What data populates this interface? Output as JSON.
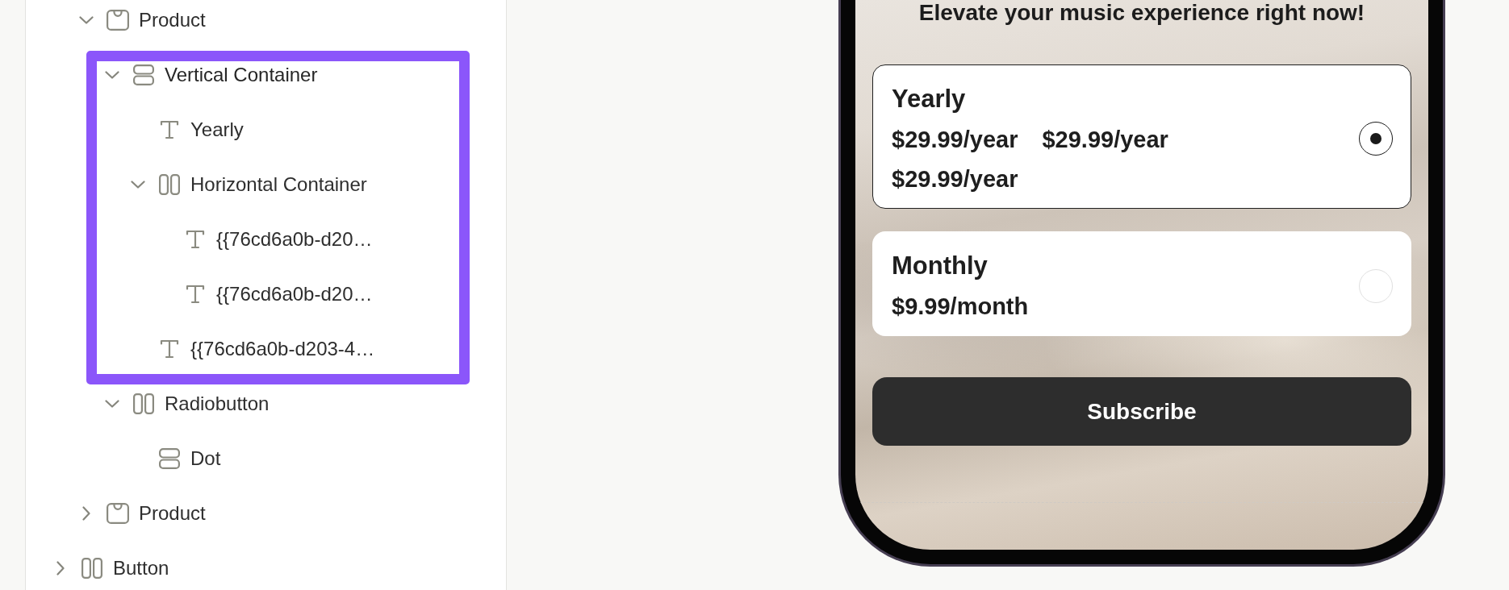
{
  "tree": [
    {
      "children": [
        {
          "label": "Product",
          "kind": "product",
          "expanded": true,
          "selected": false,
          "children": [
            {
              "label": "Vertical Container",
              "kind": "vstack",
              "expanded": true,
              "selected": true,
              "children": [
                {
                  "label": "Yearly",
                  "kind": "text",
                  "selected": false
                },
                {
                  "label": "Horizontal Container",
                  "kind": "hstack",
                  "expanded": true,
                  "selected": false,
                  "children": [
                    {
                      "label": "{{76cd6a0b-d20…",
                      "kind": "text",
                      "selected": false
                    },
                    {
                      "label": "{{76cd6a0b-d20…",
                      "kind": "text",
                      "selected": false
                    }
                  ]
                },
                {
                  "label": "{{76cd6a0b-d203-4…",
                  "kind": "text",
                  "selected": false
                }
              ]
            },
            {
              "label": "Radiobutton",
              "kind": "hstack",
              "expanded": true,
              "selected": false,
              "children": [
                {
                  "label": "Dot",
                  "kind": "vstack",
                  "selected": false
                }
              ]
            }
          ]
        },
        {
          "label": "Product",
          "kind": "product",
          "expanded": false,
          "selected": false
        }
      ]
    },
    {
      "label": "Button",
      "kind": "hstack",
      "expanded": false,
      "selected": false
    }
  ],
  "preview": {
    "heading": "Elevate your music experience right now!",
    "plans": [
      {
        "name": "Yearly",
        "price_row": [
          "$29.99/year",
          "$29.99/year"
        ],
        "price_lines": [
          "$29.99/year"
        ],
        "selected": true
      },
      {
        "name": "Monthly",
        "price_row": [
          "$9.99/month"
        ],
        "selected": false
      }
    ],
    "button": "Subscribe"
  }
}
